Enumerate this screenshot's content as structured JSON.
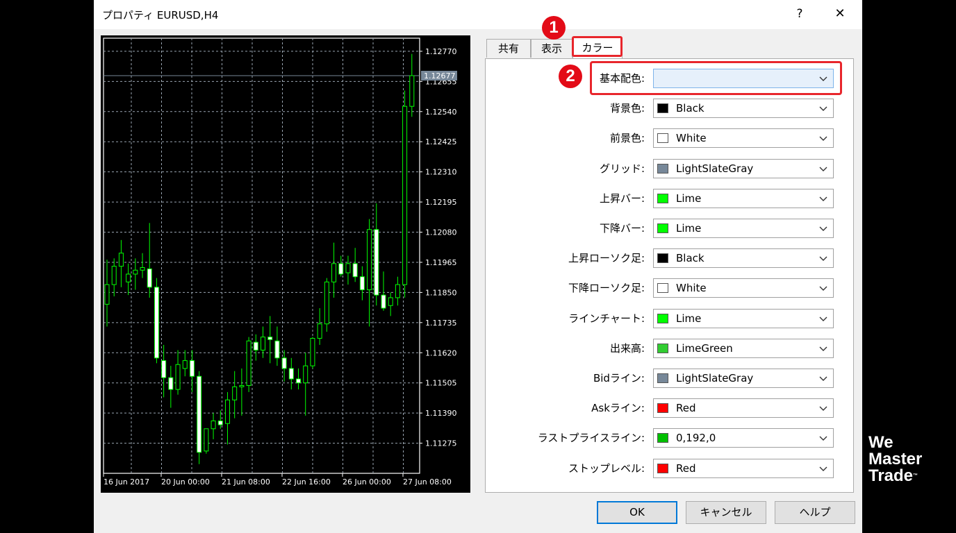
{
  "window": {
    "title": "プロパティ EURUSD,H4",
    "help_label": "?",
    "close_label": "✕"
  },
  "tabs": [
    {
      "label": "共有"
    },
    {
      "label": "表示"
    },
    {
      "label": "カラー"
    }
  ],
  "annotations": {
    "badge1": "1",
    "badge2": "2"
  },
  "chart_data": {
    "type": "candlestick",
    "symbol": "EURUSD",
    "timeframe": "H4",
    "price_labels": [
      "1.12770",
      "1.12655",
      "1.12540",
      "1.12425",
      "1.12310",
      "1.12195",
      "1.12080",
      "1.11965",
      "1.11850",
      "1.11735",
      "1.11620",
      "1.11505",
      "1.11390",
      "1.11275"
    ],
    "current_price": "1.12677",
    "time_labels": [
      "16 Jun 2017",
      "20 Jun 00:00",
      "21 Jun 08:00",
      "22 Jun 16:00",
      "26 Jun 00:00",
      "27 Jun 08:00"
    ],
    "ylim": [
      1.1116,
      1.1282
    ],
    "background": "#000000",
    "grid": true,
    "candle_color": "#00ff00",
    "bull_body": "#000000",
    "bear_body": "#ffffff",
    "candles": [
      {
        "o": 1.11805,
        "h": 1.11975,
        "l": 1.1172,
        "c": 1.1188
      },
      {
        "o": 1.1188,
        "h": 1.1198,
        "l": 1.11835,
        "c": 1.1195
      },
      {
        "o": 1.1195,
        "h": 1.1205,
        "l": 1.1187,
        "c": 1.12
      },
      {
        "o": 1.1189,
        "h": 1.1196,
        "l": 1.1184,
        "c": 1.1192
      },
      {
        "o": 1.1192,
        "h": 1.1198,
        "l": 1.1186,
        "c": 1.11935
      },
      {
        "o": 1.11935,
        "h": 1.12,
        "l": 1.11905,
        "c": 1.11945
      },
      {
        "o": 1.1194,
        "h": 1.12115,
        "l": 1.1183,
        "c": 1.1187
      },
      {
        "o": 1.1187,
        "h": 1.11905,
        "l": 1.1158,
        "c": 1.116
      },
      {
        "o": 1.1159,
        "h": 1.1165,
        "l": 1.1145,
        "c": 1.11525
      },
      {
        "o": 1.11525,
        "h": 1.1157,
        "l": 1.1141,
        "c": 1.1148
      },
      {
        "o": 1.1148,
        "h": 1.1163,
        "l": 1.1146,
        "c": 1.11575
      },
      {
        "o": 1.1156,
        "h": 1.1163,
        "l": 1.1153,
        "c": 1.1159
      },
      {
        "o": 1.1159,
        "h": 1.1163,
        "l": 1.1147,
        "c": 1.1153
      },
      {
        "o": 1.1153,
        "h": 1.1155,
        "l": 1.11195,
        "c": 1.1124
      },
      {
        "o": 1.11245,
        "h": 1.1133,
        "l": 1.11235,
        "c": 1.1133
      },
      {
        "o": 1.1133,
        "h": 1.1139,
        "l": 1.1129,
        "c": 1.1136
      },
      {
        "o": 1.1136,
        "h": 1.114,
        "l": 1.1133,
        "c": 1.11345
      },
      {
        "o": 1.1135,
        "h": 1.1147,
        "l": 1.1127,
        "c": 1.1144
      },
      {
        "o": 1.1144,
        "h": 1.1155,
        "l": 1.1137,
        "c": 1.1149
      },
      {
        "o": 1.1149,
        "h": 1.1156,
        "l": 1.1138,
        "c": 1.11495
      },
      {
        "o": 1.11495,
        "h": 1.1168,
        "l": 1.1147,
        "c": 1.11665
      },
      {
        "o": 1.1166,
        "h": 1.1169,
        "l": 1.1159,
        "c": 1.1163
      },
      {
        "o": 1.1163,
        "h": 1.1172,
        "l": 1.116,
        "c": 1.1168
      },
      {
        "o": 1.1168,
        "h": 1.1176,
        "l": 1.1158,
        "c": 1.1167
      },
      {
        "o": 1.11665,
        "h": 1.1172,
        "l": 1.1157,
        "c": 1.116
      },
      {
        "o": 1.116,
        "h": 1.1163,
        "l": 1.1151,
        "c": 1.1156
      },
      {
        "o": 1.1156,
        "h": 1.116,
        "l": 1.1148,
        "c": 1.1152
      },
      {
        "o": 1.1152,
        "h": 1.1156,
        "l": 1.1148,
        "c": 1.11505
      },
      {
        "o": 1.11505,
        "h": 1.1162,
        "l": 1.1138,
        "c": 1.1157
      },
      {
        "o": 1.1157,
        "h": 1.1168,
        "l": 1.1156,
        "c": 1.11675
      },
      {
        "o": 1.11675,
        "h": 1.1179,
        "l": 1.1165,
        "c": 1.1173
      },
      {
        "o": 1.1173,
        "h": 1.11905,
        "l": 1.117,
        "c": 1.1189
      },
      {
        "o": 1.1189,
        "h": 1.1204,
        "l": 1.1183,
        "c": 1.1196
      },
      {
        "o": 1.1196,
        "h": 1.1199,
        "l": 1.1191,
        "c": 1.1192
      },
      {
        "o": 1.11925,
        "h": 1.1199,
        "l": 1.1188,
        "c": 1.1196
      },
      {
        "o": 1.1196,
        "h": 1.1202,
        "l": 1.1189,
        "c": 1.1191
      },
      {
        "o": 1.1191,
        "h": 1.1195,
        "l": 1.1182,
        "c": 1.1186
      },
      {
        "o": 1.1186,
        "h": 1.1213,
        "l": 1.1172,
        "c": 1.1209
      },
      {
        "o": 1.1209,
        "h": 1.1219,
        "l": 1.118,
        "c": 1.1184
      },
      {
        "o": 1.1184,
        "h": 1.1193,
        "l": 1.1178,
        "c": 1.1179
      },
      {
        "o": 1.118,
        "h": 1.1185,
        "l": 1.1176,
        "c": 1.1183
      },
      {
        "o": 1.1183,
        "h": 1.1191,
        "l": 1.118,
        "c": 1.1188
      },
      {
        "o": 1.1188,
        "h": 1.1262,
        "l": 1.1183,
        "c": 1.1256
      },
      {
        "o": 1.1256,
        "h": 1.1276,
        "l": 1.1252,
        "c": 1.12677
      }
    ]
  },
  "color_rows": [
    {
      "label": "基本配色:",
      "value": "",
      "swatch": "",
      "active": true
    },
    {
      "label": "背景色:",
      "value": "Black",
      "swatch": "#000000"
    },
    {
      "label": "前景色:",
      "value": "White",
      "swatch": "#ffffff"
    },
    {
      "label": "グリッド:",
      "value": "LightSlateGray",
      "swatch": "#778899"
    },
    {
      "label": "上昇バー:",
      "value": "Lime",
      "swatch": "#00ff00"
    },
    {
      "label": "下降バー:",
      "value": "Lime",
      "swatch": "#00ff00"
    },
    {
      "label": "上昇ローソク足:",
      "value": "Black",
      "swatch": "#000000"
    },
    {
      "label": "下降ローソク足:",
      "value": "White",
      "swatch": "#ffffff"
    },
    {
      "label": "ラインチャート:",
      "value": "Lime",
      "swatch": "#00ff00"
    },
    {
      "label": "出来高:",
      "value": "LimeGreen",
      "swatch": "#32cd32"
    },
    {
      "label": "Bidライン:",
      "value": "LightSlateGray",
      "swatch": "#778899"
    },
    {
      "label": "Askライン:",
      "value": "Red",
      "swatch": "#ff0000"
    },
    {
      "label": "ラストプライスライン:",
      "value": "0,192,0",
      "swatch": "#00c000"
    },
    {
      "label": "ストップレベル:",
      "value": "Red",
      "swatch": "#ff0000"
    }
  ],
  "buttons": {
    "ok": "OK",
    "cancel": "キャンセル",
    "help": "ヘルプ"
  },
  "logo": {
    "line1": "We",
    "line2": "Master",
    "line3": "Trade",
    "tm": "™"
  }
}
